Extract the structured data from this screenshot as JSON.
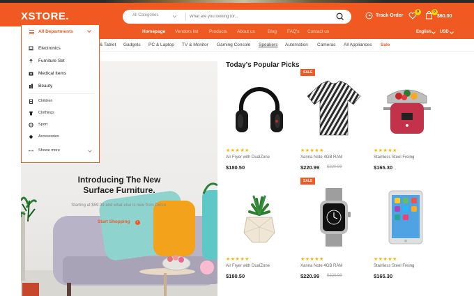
{
  "brand": {
    "logo": "XSTORE.",
    "accent": "#f05a22",
    "star_color": "#f8b400"
  },
  "search": {
    "category": "All Categories",
    "placeholder": "What are you looking for..."
  },
  "header": {
    "track_order": "Track Order",
    "wishlist_count": "0",
    "cart_count": "0",
    "cart_total": "$60.00"
  },
  "nav": {
    "items": [
      "Homepage",
      "Vendors list",
      "Products",
      "About us",
      "Blog",
      "FAQ's",
      "Contact us"
    ],
    "active_index": 0,
    "language": "English",
    "currency": "USD"
  },
  "categories": [
    "& Tablet",
    "Gadgets",
    "PC & Laptop",
    "TV & Monitor",
    "Gaming Console",
    "Speakers",
    "Automation",
    "Cameras",
    "All Appliances",
    "Sale"
  ],
  "departments": {
    "title": "All Departments",
    "items": [
      "Electronics",
      "Furniture Set",
      "Medical Items",
      "Beauty"
    ],
    "sub_items": [
      "Children",
      "Clothings",
      "Sport",
      "Accessories"
    ],
    "show_more": "Showe more"
  },
  "hero": {
    "title_line1": "Introducing The New",
    "title_line2": "Surface Furniture.",
    "subtitle": "Starting at $59.99 and what else is new from Decor.",
    "cta": "Start Shopping"
  },
  "popular": {
    "title": "Today's Popular Picks",
    "products": [
      {
        "name": "Air Fryer with DualZone",
        "price": "$180.50",
        "old_price": "",
        "sale": "",
        "rating": 5,
        "icon": "headphones-image"
      },
      {
        "name": "Xanna Note 4GB RAM",
        "price": "$220.99",
        "old_price": "$220.99",
        "sale": "SALE",
        "rating": 5,
        "icon": "tshirt-image"
      },
      {
        "name": "Stainless Steel Freing",
        "price": "$165.30",
        "old_price": "",
        "sale": "",
        "rating": 5,
        "icon": "rice-cooker-image"
      },
      {
        "name": "Air Fryer with DualZone",
        "price": "$180.50",
        "old_price": "",
        "sale": "",
        "rating": 5,
        "icon": "plant-pot-image"
      },
      {
        "name": "Xanna Note 4GB RAM",
        "price": "$220.99",
        "old_price": "$220.99",
        "sale": "SALE",
        "rating": 5,
        "icon": "smartwatch-image"
      },
      {
        "name": "Stainless Steel Freing",
        "price": "$165.30",
        "old_price": "",
        "sale": "",
        "rating": 5,
        "icon": "tablet-image"
      }
    ]
  }
}
